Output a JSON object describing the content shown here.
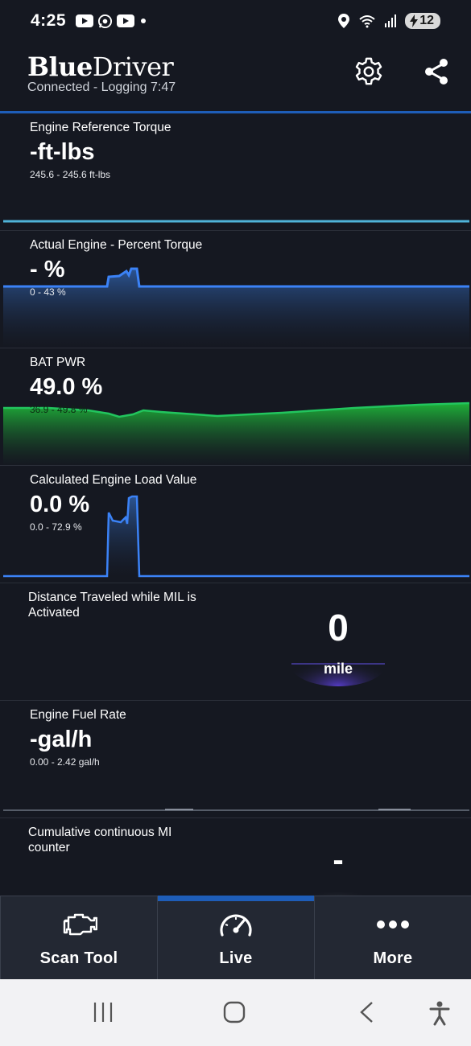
{
  "status_bar": {
    "time": "4:25",
    "battery": "12"
  },
  "header": {
    "logo_bold": "Blue",
    "logo_regular": "Driver",
    "subtitle": "Connected - Logging 7:47"
  },
  "cards": [
    {
      "title": "Engine Reference Torque",
      "value": "-ft-lbs",
      "range": "245.6 - 245.6 ft-lbs"
    },
    {
      "title": "Actual Engine - Percent Torque",
      "value": "- %",
      "range": "0 - 43 %"
    },
    {
      "title": "BAT PWR",
      "value": "49.0 %",
      "range": "36.9 - 49.8 %"
    },
    {
      "title": "Calculated Engine Load Value",
      "value": "0.0 %",
      "range": "0.0 - 72.9 %"
    },
    {
      "title_line1": "Distance Traveled while MIL is",
      "title_line2": "Activated",
      "value": "0",
      "unit": "mile"
    },
    {
      "title": "Engine Fuel Rate",
      "value": "-gal/h",
      "range": "0.00 - 2.42 gal/h"
    },
    {
      "title_line1": "Cumulative continuous MI",
      "title_line2": "counter",
      "value": "-"
    }
  ],
  "bottom_nav": {
    "tabs": [
      {
        "label": "Scan Tool",
        "icon": "engine-icon"
      },
      {
        "label": "Live",
        "icon": "speedometer-icon",
        "active": true
      },
      {
        "label": "More",
        "icon": "more-dots-icon"
      }
    ]
  },
  "colors": {
    "background": "#151821",
    "accent_blue": "#1e5db8",
    "graph_blue": "#3b82f6",
    "graph_green": "#22c55e",
    "cyan_line": "#4fb3d9"
  }
}
